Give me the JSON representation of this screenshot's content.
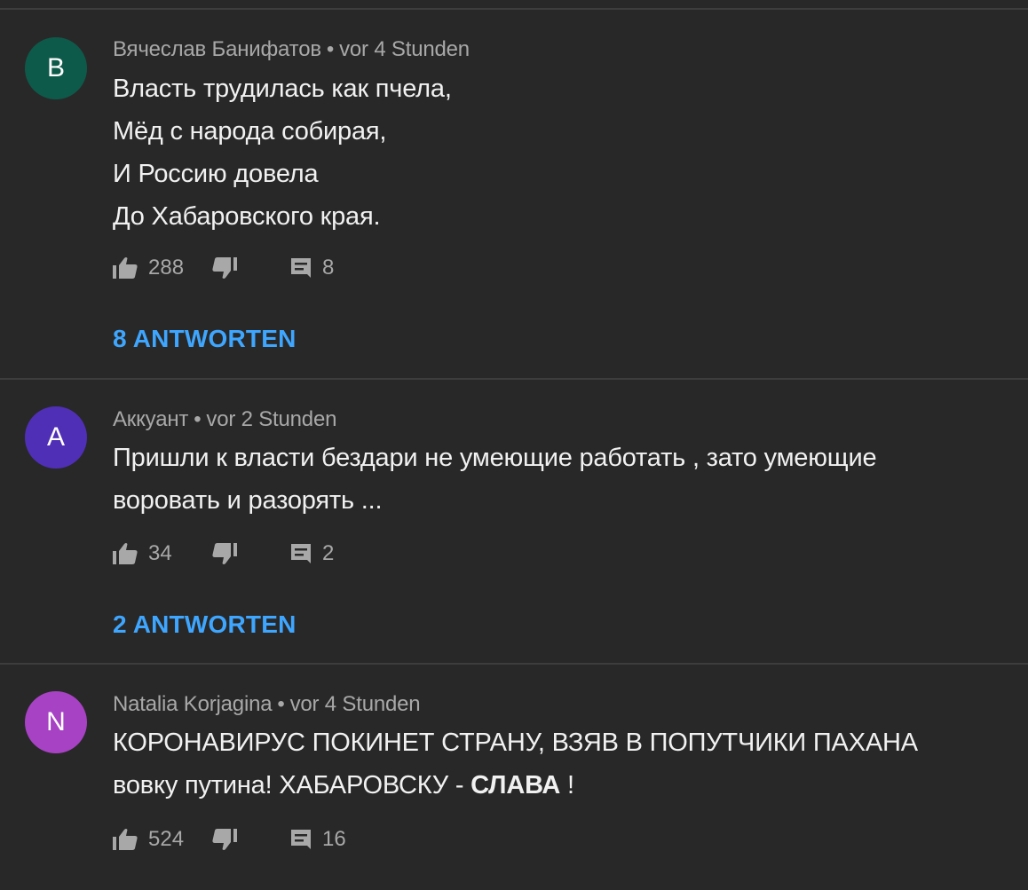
{
  "comments": [
    {
      "avatar_letter": "B",
      "avatar_color": "#0e5a4a",
      "author": "Вячеслав Банифатов",
      "separator": "•",
      "time": "vor 4 Stunden",
      "lines": [
        "Власть трудилась как пчела,",
        "Мёд с народа собирая,",
        "И Россию довела",
        "До Хабаровского края."
      ],
      "likes": "288",
      "reply_count": "8",
      "replies_label": "8 ANTWORTEN"
    },
    {
      "avatar_letter": "A",
      "avatar_color": "#4f2fb5",
      "author": "Аккуант",
      "separator": "•",
      "time": "vor 2 Stunden",
      "lines": [
        "Пришли к власти бездари не умеющие работать , зато умеющие",
        "воровать и разорять ..."
      ],
      "likes": "34",
      "reply_count": "2",
      "replies_label": "2 ANTWORTEN"
    },
    {
      "avatar_letter": "N",
      "avatar_color": "#a742c4",
      "author": "Natalia Korjagina",
      "separator": "•",
      "time": "vor 4 Stunden",
      "lines": [
        "КОРОНАВИРУС ПОКИНЕТ СТРАНУ, ВЗЯВ В ПОПУТЧИКИ ПАХАНА",
        "вовку путина! ХАБАРОВСКУ - "
      ],
      "bold_text": "СЛАВА",
      "line_end": " !",
      "likes": "524",
      "reply_count": "16"
    }
  ],
  "icons": {
    "like": "thumbs-up-icon",
    "dislike": "thumbs-down-icon",
    "reply": "comment-icon"
  },
  "colors": {
    "background": "#282828",
    "link": "#3ea6ff",
    "muted": "#a8a8a8",
    "text": "#f1f1f1"
  }
}
